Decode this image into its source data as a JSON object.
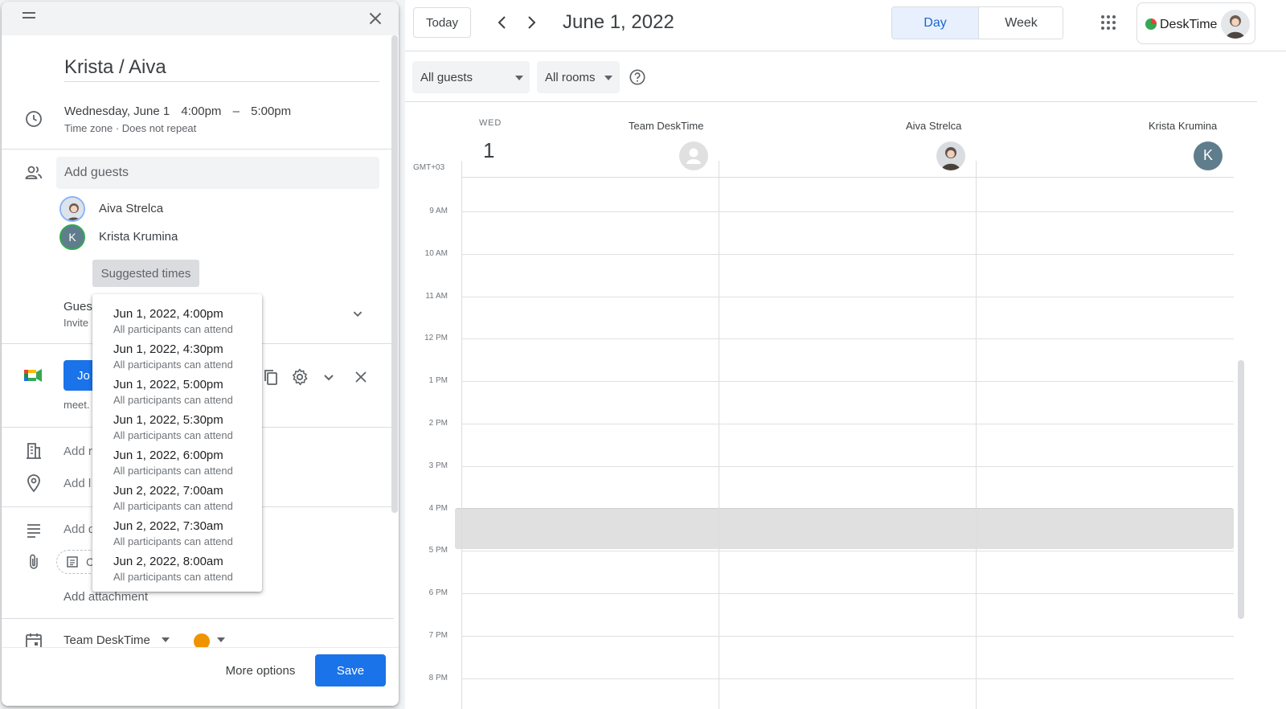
{
  "event": {
    "title": "Krista / Aiva",
    "date": "Wednesday, June 1",
    "start_time": "4:00pm",
    "dash": "–",
    "end_time": "5:00pm",
    "timezone_text": "Time zone · Does not repeat",
    "add_guests_placeholder": "Add guests",
    "guests": [
      {
        "name": "Aiva Strelca"
      },
      {
        "name": "Krista Krumina",
        "initial": "K"
      }
    ],
    "suggested_times_label": "Suggested times",
    "permissions_title": "Gues",
    "permissions_sub": "Invite",
    "join_label": "Jo",
    "meet_link": "meet.",
    "add_rooms": "Add r",
    "add_location": "Add l",
    "add_description": "Add d",
    "attachment_chip_letter": "C",
    "add_attachment": "Add attachment",
    "calendar_name": "Team DeskTime",
    "more_options": "More options",
    "save": "Save",
    "event_color": "#f09300"
  },
  "suggestions": [
    {
      "time": "Jun 1, 2022, 4:00pm",
      "note": "All participants can attend"
    },
    {
      "time": "Jun 1, 2022, 4:30pm",
      "note": "All participants can attend"
    },
    {
      "time": "Jun 1, 2022, 5:00pm",
      "note": "All participants can attend"
    },
    {
      "time": "Jun 1, 2022, 5:30pm",
      "note": "All participants can attend"
    },
    {
      "time": "Jun 1, 2022, 6:00pm",
      "note": "All participants can attend"
    },
    {
      "time": "Jun 2, 2022, 7:00am",
      "note": "All participants can attend"
    },
    {
      "time": "Jun 2, 2022, 7:30am",
      "note": "All participants can attend"
    },
    {
      "time": "Jun 2, 2022, 8:00am",
      "note": "All participants can attend"
    }
  ],
  "calendar": {
    "today": "Today",
    "date_title": "June 1, 2022",
    "views": {
      "day": "Day",
      "week": "Week",
      "active": "day"
    },
    "brand": "DeskTime",
    "filters": {
      "guests": "All guests",
      "rooms": "All rooms"
    },
    "day_abbr": "WED",
    "day_num": "1",
    "timezone": "GMT+03",
    "columns": [
      {
        "name": "Team DeskTime"
      },
      {
        "name": "Aiva Strelca"
      },
      {
        "name": "Krista Krumina",
        "initial": "K"
      }
    ],
    "hours": [
      "9 AM",
      "10 AM",
      "11 AM",
      "12 PM",
      "1 PM",
      "2 PM",
      "3 PM",
      "4 PM",
      "5 PM",
      "6 PM",
      "7 PM",
      "8 PM"
    ],
    "accent": "#1a73e8",
    "active_view_bg": "#e8f0fe"
  }
}
